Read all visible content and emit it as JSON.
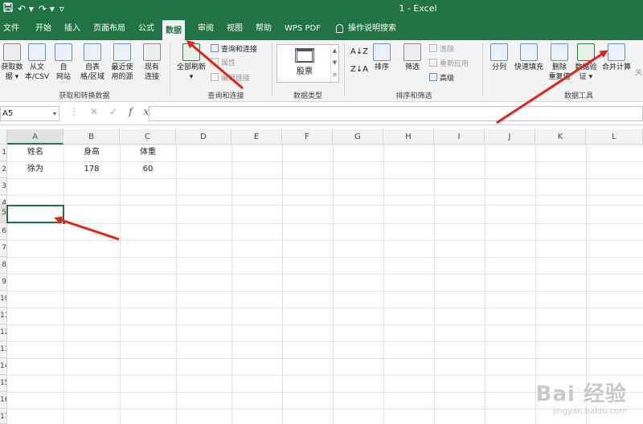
{
  "app": {
    "title": "1  -  Excel",
    "accent": "#217346"
  },
  "qat": {
    "save_icon": "save-icon",
    "undo": "↶ ▾",
    "redo": "↷ ▾",
    "customize": "▿"
  },
  "tabs": [
    {
      "label": "文件"
    },
    {
      "label": "开始"
    },
    {
      "label": "插入"
    },
    {
      "label": "页面布局"
    },
    {
      "label": "公式"
    },
    {
      "label": "数据",
      "active": true
    },
    {
      "label": "审阅"
    },
    {
      "label": "视图"
    },
    {
      "label": "帮助"
    },
    {
      "label": "WPS PDF"
    },
    {
      "label": "操作说明搜索"
    }
  ],
  "ribbon": {
    "get_transform": {
      "label": "获取和转换数据",
      "buttons": [
        "获取数\n据 ▾",
        "从文\n本/CSV",
        "自\n网站",
        "自表\n格/区域",
        "最近使\n用的源",
        "现有\n连接"
      ]
    },
    "queries": {
      "label": "查询和连接",
      "refresh_all": "全部刷新",
      "refresh_arrow": "▾",
      "items": [
        "查询和连接",
        "属性",
        "编辑链接"
      ]
    },
    "data_types": {
      "label": "数据类型",
      "stock": "股票"
    },
    "sort_filter": {
      "label": "排序和筛选",
      "sort_az": "A↓Z",
      "sort_za": "Z↓A",
      "sort": "排序",
      "filter": "筛选",
      "items": [
        "清除",
        "重新应用",
        "高级"
      ]
    },
    "data_tools": {
      "label": "数据工具",
      "buttons": [
        "分列",
        "快速填充",
        "删除\n重复值",
        "数据验\n证 ▾",
        "合并计算"
      ],
      "extra": "关"
    }
  },
  "formula_bar": {
    "name_box": "A5",
    "dropdown": "▾",
    "dots": "⋮",
    "cancel": "✕",
    "enter": "✓",
    "fx": "fx",
    "value": ""
  },
  "sheet": {
    "columns": [
      "A",
      "B",
      "C",
      "D",
      "E",
      "F",
      "G",
      "H",
      "I",
      "J",
      "K",
      "L"
    ],
    "rows": [
      "1",
      "2",
      "3",
      "4",
      "5",
      "6",
      "7",
      "8",
      "9",
      "10",
      "11",
      "12",
      "13",
      "14",
      "15",
      "16",
      "17"
    ],
    "cells": {
      "A1": "姓名",
      "B1": "身高",
      "C1": "体重",
      "A2": "徐为",
      "B2": "178",
      "C2": "60"
    },
    "selected_cell": "A5"
  },
  "annotations": {
    "arrow_color": "#e3211b"
  },
  "watermark": {
    "main": "Bai 经验",
    "sub": "jingyan.baidu.com"
  }
}
